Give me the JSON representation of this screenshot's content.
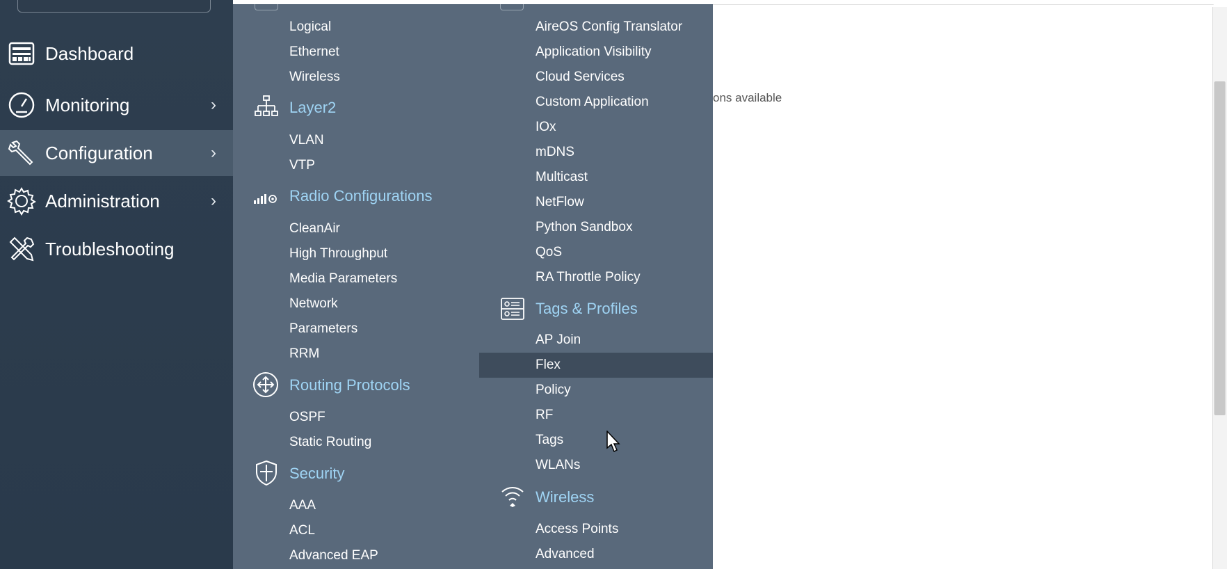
{
  "sidebar": {
    "items": [
      {
        "label": "Dashboard",
        "icon": "dashboard-icon",
        "has_submenu": false,
        "active": false
      },
      {
        "label": "Monitoring",
        "icon": "gauge-icon",
        "has_submenu": true,
        "active": false
      },
      {
        "label": "Configuration",
        "icon": "wrench-icon",
        "has_submenu": true,
        "active": true
      },
      {
        "label": "Administration",
        "icon": "gear-icon",
        "has_submenu": true,
        "active": false
      },
      {
        "label": "Troubleshooting",
        "icon": "tools-icon",
        "has_submenu": false,
        "active": false
      }
    ],
    "chevron": "›"
  },
  "menu": {
    "col1": {
      "interface_items": [
        "Logical",
        "Ethernet",
        "Wireless"
      ],
      "layer2": {
        "title": "Layer2",
        "items": [
          "VLAN",
          "VTP"
        ]
      },
      "radio": {
        "title": "Radio Configurations",
        "items": [
          "CleanAir",
          "High Throughput",
          "Media Parameters",
          "Network",
          "Parameters",
          "RRM"
        ]
      },
      "routing": {
        "title": "Routing Protocols",
        "items": [
          "OSPF",
          "Static Routing"
        ]
      },
      "security": {
        "title": "Security",
        "items": [
          "AAA",
          "ACL",
          "Advanced EAP"
        ]
      }
    },
    "col2": {
      "services_items": [
        "AireOS Config Translator",
        "Application Visibility",
        "Cloud Services",
        "Custom Application",
        "IOx",
        "mDNS",
        "Multicast",
        "NetFlow",
        "Python Sandbox",
        "QoS",
        "RA Throttle Policy"
      ],
      "tags": {
        "title": "Tags & Profiles",
        "items": [
          "AP Join",
          "Flex",
          "Policy",
          "RF",
          "Tags",
          "WLANs"
        ],
        "hovered": "Flex"
      },
      "wireless": {
        "title": "Wireless",
        "items": [
          "Access Points",
          "Advanced"
        ]
      }
    }
  },
  "content": {
    "partial_text": "ons available"
  },
  "colors": {
    "sidebar_bg": "#2e3e4f",
    "flyout_bg": "#59697b",
    "section_title": "#9fd4f4",
    "hover_row": "#3e4c5c",
    "active_nav": "#4a5b6c"
  }
}
